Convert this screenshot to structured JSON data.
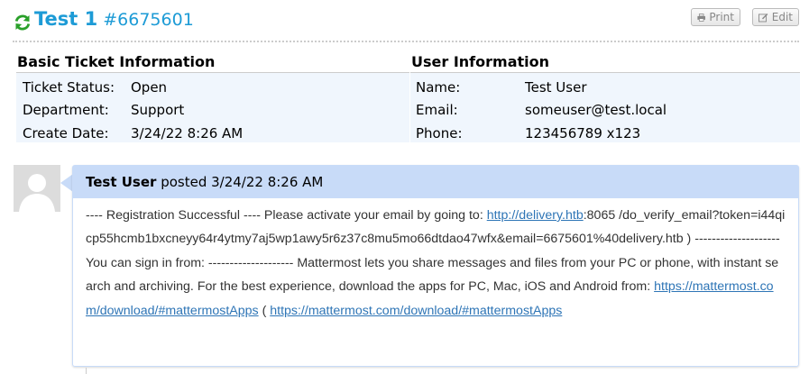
{
  "header": {
    "title": "Test 1",
    "ticket_number": "#6675601",
    "print_label": "Print",
    "edit_label": "Edit"
  },
  "basic_info": {
    "heading": "Basic Ticket Information",
    "rows": [
      {
        "label": "Ticket Status:",
        "value": "Open"
      },
      {
        "label": "Department:",
        "value": "Support"
      },
      {
        "label": "Create Date:",
        "value": "3/24/22 8:26 AM"
      }
    ]
  },
  "user_info": {
    "heading": "User Information",
    "rows": [
      {
        "label": "Name:",
        "value": "Test User"
      },
      {
        "label": "Email:",
        "value": "someuser@test.local"
      },
      {
        "label": "Phone:",
        "value": "123456789 x123"
      }
    ]
  },
  "thread": {
    "author": "Test User",
    "posted_text": "posted 3/24/22 8:26 AM",
    "body_part1": "---- Registration Successful ---- Please activate your email by going to: ",
    "link1": "http://delivery.htb",
    "body_part2": ":8065 /do_verify_email?token=i44qicp55hcmb1bxcneyy64r4ytmy7aj5wp1awy5r6z37c8mu5mo66dtdao47wfx&email=6675601%40delivery.htb ) -------------------- You can sign in from: -------------------- Mattermost lets you share messages and files from your PC or phone, with instant search and archiving. For the best experience, download the apps for PC, Mac, iOS and Android from: ",
    "link2": "https://mattermost.com/download/#mattermostApps",
    "body_part3": " ( ",
    "link3": "https://mattermost.com/download/#mattermostApps"
  },
  "colors": {
    "title": "#1d9bd6",
    "refresh_icon": "#2aa02a",
    "info_background": "#f0f6fd",
    "thread_header": "#c8dbf8",
    "link": "#2e75b6"
  }
}
